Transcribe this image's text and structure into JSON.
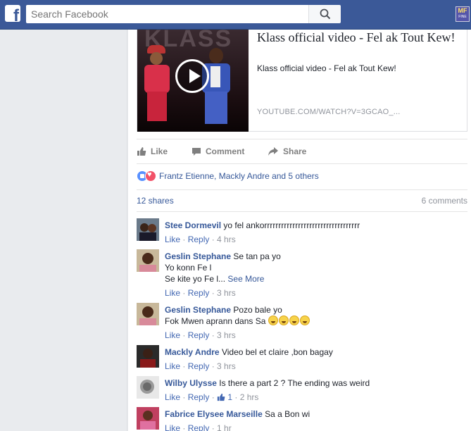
{
  "topbar": {
    "logo": "f",
    "search_placeholder": "Search Facebook",
    "corner_logo_top": "MF",
    "corner_logo_bottom": "FINE"
  },
  "link_preview": {
    "title": "Klass official video - Fel ak Tout Kew!",
    "description": "Klass official video - Fel ak Tout Kew!",
    "url": "YOUTUBE.COM/WATCH?V=3GCAO_..."
  },
  "actions": {
    "like": "Like",
    "comment": "Comment",
    "share": "Share"
  },
  "reactions": {
    "names": "Frantz Etienne, Mackly Andre and 5 others"
  },
  "stats": {
    "shares": "12 shares",
    "comments": "6 comments"
  },
  "comments": [
    {
      "name": "Stee Dormevil",
      "text": "yo fel ankorrrrrrrrrrrrrrrrrrrrrrrrrrrrrrrrrr",
      "like": "Like",
      "reply": "Reply",
      "time": "4 hrs"
    },
    {
      "name": "Geslin Stephane",
      "line1": "Se tan pa yo",
      "line2": "Yo konn Fe l",
      "line3": "Se kite yo Fe l...",
      "see_more": "See More",
      "like": "Like",
      "reply": "Reply",
      "time": "3 hrs"
    },
    {
      "name": "Geslin Stephane",
      "line1": "Pozo bale yo",
      "line2": "Fok Mwen aprann dans Sa",
      "like": "Like",
      "reply": "Reply",
      "time": "3 hrs"
    },
    {
      "name": "Mackly Andre",
      "text": "Video bel et claire ,bon bagay",
      "like": "Like",
      "reply": "Reply",
      "time": "3 hrs"
    },
    {
      "name": "Wilby Ulysse",
      "text": "Is there a part 2 ? The ending was weird",
      "like": "Like",
      "reply": "Reply",
      "likes": "1",
      "time": "2 hrs"
    },
    {
      "name": "Fabrice Elysee Marseille",
      "text": "Sa a Bon wi",
      "like": "Like",
      "reply": "Reply",
      "time": "1 hr"
    }
  ],
  "colors": {
    "topbar": "#3b5998",
    "link": "#365899",
    "meta": "#90949c"
  }
}
